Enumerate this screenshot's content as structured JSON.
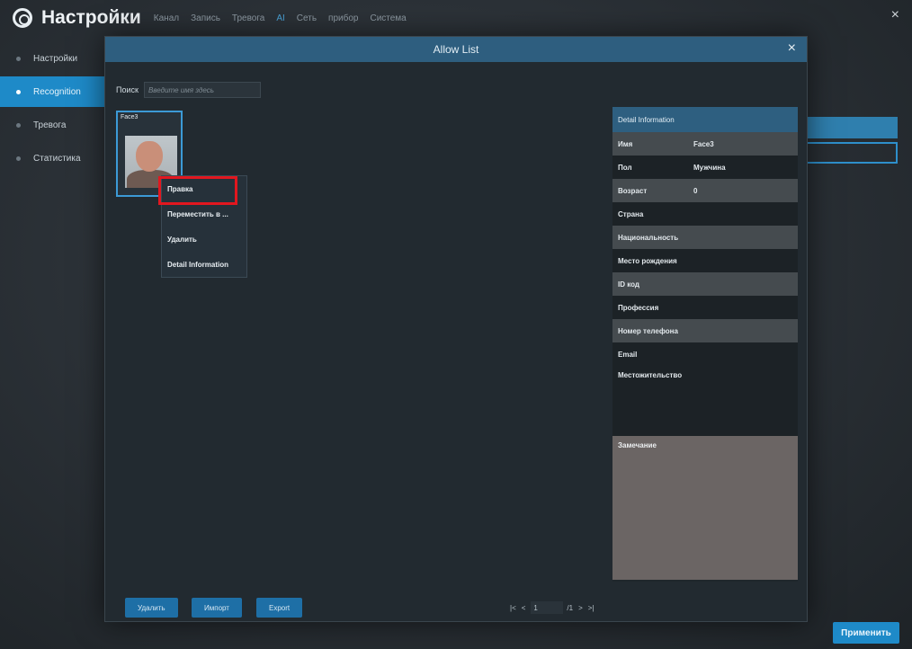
{
  "header": {
    "title": "Настройки",
    "tabs": [
      "Канал",
      "Запись",
      "Тревога",
      "AI",
      "Сеть",
      "прибор",
      "Система"
    ],
    "active_tab_index": 3,
    "close_glyph": "×"
  },
  "sidebar": {
    "items": [
      {
        "label": "Настройки"
      },
      {
        "label": "Recognition"
      },
      {
        "label": "Тревога"
      },
      {
        "label": "Статистика"
      }
    ],
    "active_index": 1
  },
  "modal": {
    "title": "Allow List",
    "close_glyph": "×",
    "search": {
      "label": "Поиск",
      "placeholder": "Введите имя здесь"
    },
    "face_card": {
      "name": "Face3"
    },
    "context_menu": {
      "items": [
        "Правка",
        "Переместить в ...",
        "Удалить",
        "Detail Information"
      ],
      "highlighted_index": 0
    },
    "detail": {
      "header": "Detail Information",
      "rows": [
        {
          "label": "Имя",
          "value": "Face3"
        },
        {
          "label": "Пол",
          "value": "Мужчина"
        },
        {
          "label": "Возраст",
          "value": "0"
        },
        {
          "label": "Страна",
          "value": ""
        },
        {
          "label": "Национальность",
          "value": ""
        },
        {
          "label": "Место рождения",
          "value": ""
        },
        {
          "label": "ID код",
          "value": ""
        },
        {
          "label": "Профессия",
          "value": ""
        },
        {
          "label": "Номер телефона",
          "value": ""
        },
        {
          "label": "Email",
          "value": ""
        }
      ],
      "address_label": "Местожительство",
      "note_label": "Замечание"
    },
    "footer": {
      "delete_label": "Удалить",
      "import_label": "Импорт",
      "export_label": "Export",
      "pager": {
        "first": "|<",
        "prev": "<",
        "current": "1",
        "total": "/1",
        "next": ">",
        "last": ">|"
      }
    }
  },
  "apply_button_label": "Применить",
  "colors": {
    "accent": "#1e8ac8",
    "modal_header": "#2e5e7f",
    "highlight_box": "#e2171f"
  }
}
